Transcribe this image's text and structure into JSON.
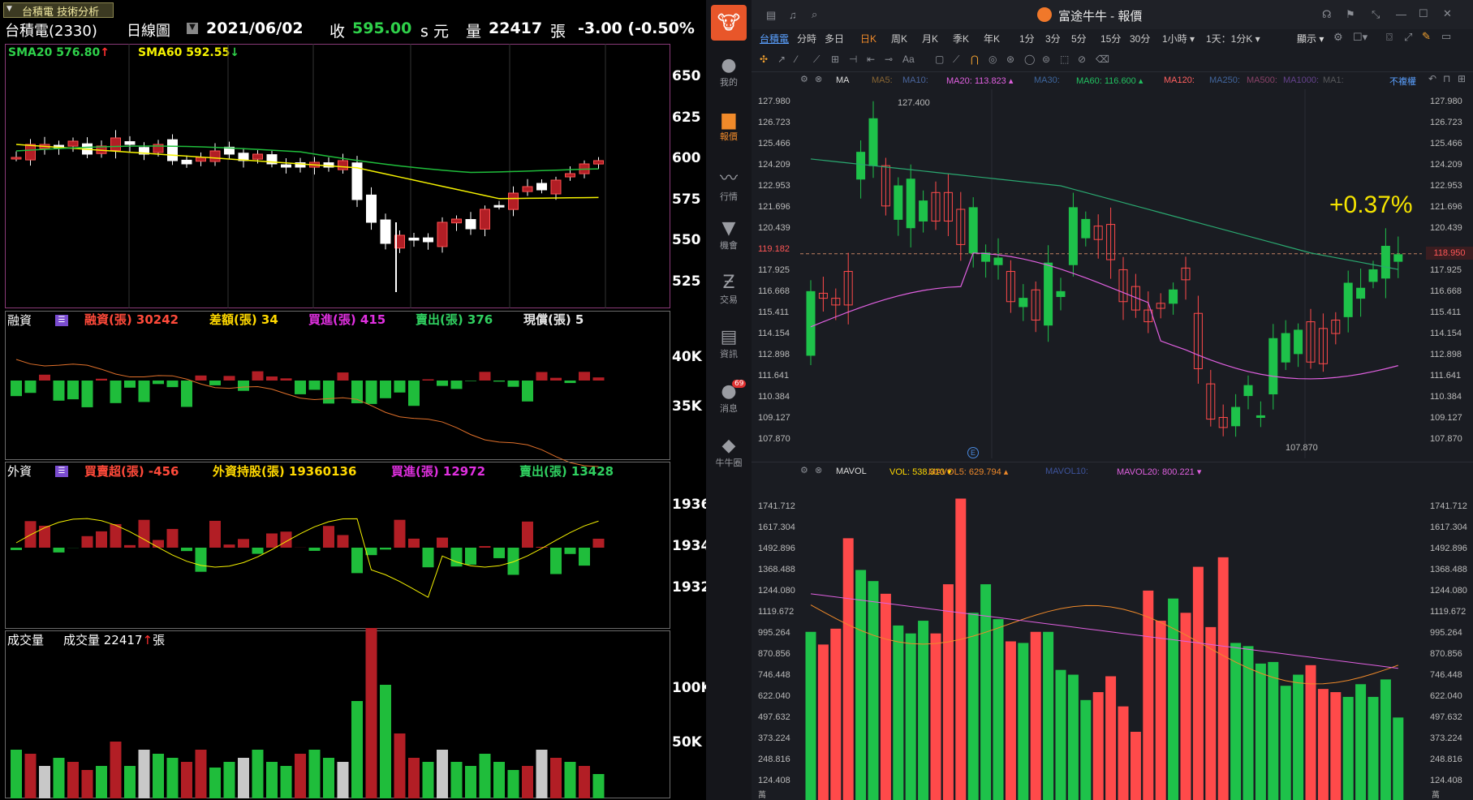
{
  "left": {
    "tab": "台積電 技術分析",
    "stock_name": "台積電(2330)",
    "period": "日線圖",
    "date": "2021/06/02",
    "close_label": "收",
    "close": "595.00",
    "close_suffix": "s 元",
    "vol_label": "量",
    "vol": "22417",
    "vol_unit": "張",
    "change": "-3.00 (-0.50%",
    "sma20": "SMA20 576.80",
    "sma60": "SMA60 592.55",
    "price_ticks": [
      "650",
      "625",
      "600",
      "575",
      "550",
      "525"
    ],
    "margin_title": "融資",
    "margin_items": [
      "融資(張) 30242",
      "差額(張) 34",
      "買進(張) 415",
      "賣出(張) 376",
      "現償(張) 5"
    ],
    "margin_ticks": [
      "40K",
      "35K"
    ],
    "foreign_title": "外資",
    "foreign_items": [
      "買賣超(張) -456",
      "外資持股(張) 19360136",
      "買進(張) 12972",
      "賣出(張) 13428"
    ],
    "foreign_ticks": [
      "1936",
      "1934",
      "1932"
    ],
    "volume_title": "成交量",
    "volume_label": "成交量 22417",
    "volume_unit": "張",
    "volume_ticks": [
      "100K",
      "50K"
    ],
    "arrows": {
      "up": "↑",
      "down": "↓"
    }
  },
  "sidebar": [
    {
      "label": "我的",
      "icon": "user-icon"
    },
    {
      "label": "報價",
      "icon": "chart-icon"
    },
    {
      "label": "行情",
      "icon": "trend-icon"
    },
    {
      "label": "機會",
      "icon": "opportunity-icon"
    },
    {
      "label": "交易",
      "icon": "trade-icon"
    },
    {
      "label": "資訊",
      "icon": "news-icon"
    },
    {
      "label": "消息",
      "icon": "message-icon",
      "badge": "69"
    },
    {
      "label": "牛牛圈",
      "icon": "community-icon"
    }
  ],
  "right": {
    "window_title": "富途牛牛 - 報價",
    "tabs": [
      "台積電",
      "分時",
      "多日",
      "日K",
      "周K",
      "月K",
      "季K",
      "年K",
      "1分",
      "3分",
      "5分",
      "15分",
      "30分",
      "1小時 ▾",
      "1天：1分K ▾"
    ],
    "display": "顯示 ▾",
    "ma_title": "MA",
    "ma_items": [
      "MA5:",
      "MA10:",
      "MA20: 113.823 ▴",
      "MA30:",
      "MA60: 116.600 ▴",
      "MA120:",
      "MA250:",
      "MA500:",
      "MA1000:",
      "MA1:"
    ],
    "no_adjust": "不複權",
    "price_ticks": [
      "127.980",
      "126.723",
      "125.466",
      "124.209",
      "122.953",
      "121.696",
      "120.439",
      "119.182",
      "117.925",
      "116.668",
      "115.411",
      "114.154",
      "112.898",
      "111.641",
      "110.384",
      "109.127",
      "107.870"
    ],
    "current_price": "118.950",
    "high_label": "127.400",
    "low_label": "107.870",
    "pct": "+0.37%",
    "event_mark": "E",
    "vol_title": "MAVOL",
    "vol_items": [
      "VOL: 538.310 ▾",
      "MAVOL5: 629.794 ▴",
      "MAVOL10:",
      "MAVOL20: 800.221 ▾"
    ],
    "vol_ticks": [
      "1741.712",
      "1617.304",
      "1492.896",
      "1368.488",
      "1244.080",
      "1119.672",
      "995.264",
      "870.856",
      "746.448",
      "622.040",
      "497.632",
      "373.224",
      "248.816",
      "124.408"
    ],
    "vol_unit": "萬"
  },
  "colors": {
    "up_red": "#c8252c",
    "down_white": "#ffffff",
    "green": "#1fbd3b",
    "yellow": "#f5f200",
    "futu_green": "#1ec24a",
    "futu_red": "#ff4a4a"
  }
}
